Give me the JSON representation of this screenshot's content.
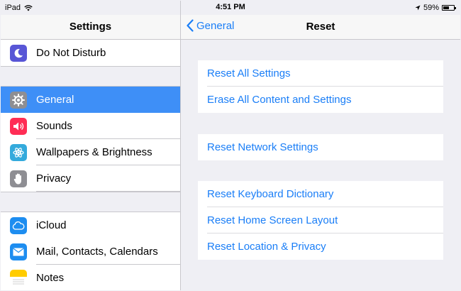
{
  "status_bar": {
    "device": "iPad",
    "time": "4:51 PM",
    "battery": "59%",
    "battery_level": 0.59
  },
  "master": {
    "title": "Settings",
    "groups": [
      [
        {
          "label": "Do Not Disturb",
          "icon": "moon-icon",
          "color": "#5856d6"
        }
      ],
      [
        {
          "label": "General",
          "icon": "gear-icon",
          "color": "#8e8e93",
          "selected": true
        },
        {
          "label": "Sounds",
          "icon": "speaker-icon",
          "color": "#ff2d55"
        },
        {
          "label": "Wallpapers & Brightness",
          "icon": "flower-icon",
          "color": "#34aadc"
        },
        {
          "label": "Privacy",
          "icon": "hand-icon",
          "color": "#8e8e93"
        }
      ],
      [
        {
          "label": "iCloud",
          "icon": "cloud-icon",
          "color": "#1d8df0"
        },
        {
          "label": "Mail, Contacts, Calendars",
          "icon": "envelope-icon",
          "color": "#1d8df0"
        },
        {
          "label": "Notes",
          "icon": "notes-icon",
          "color": "#ffcc00"
        }
      ]
    ]
  },
  "detail": {
    "back_label": "General",
    "title": "Reset",
    "groups": [
      [
        "Reset All Settings",
        "Erase All Content and Settings"
      ],
      [
        "Reset Network Settings"
      ],
      [
        "Reset Keyboard Dictionary",
        "Reset Home Screen Layout",
        "Reset Location & Privacy"
      ]
    ]
  },
  "colors": {
    "accent": "#1a7ef7",
    "selected_row": "#3e8ff7",
    "background": "#efeff4"
  }
}
